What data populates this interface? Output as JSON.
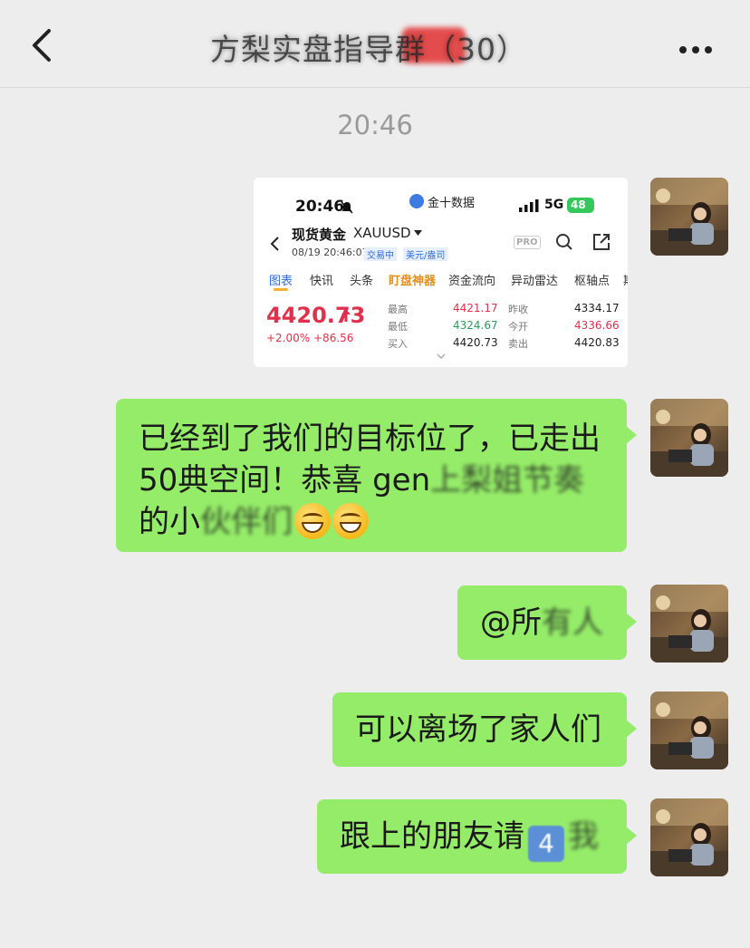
{
  "header": {
    "title": "方梨实盘指导群（30）",
    "badge": "梨"
  },
  "timestamp": "20:46",
  "messages": [
    {
      "type": "image",
      "screenshot": {
        "status_time": "20:46",
        "app_name": "金十数据",
        "network": "5G",
        "battery": "48",
        "instrument_name": "现货黄金",
        "symbol": "XAUUSD",
        "datetime": "08/19 20:46:07",
        "tag_trading": "交易中",
        "tag_currency": "美元/盎司",
        "pro_label": "PRO",
        "tabs": [
          "图表",
          "快讯",
          "头条",
          "盯盘神器",
          "资金流向",
          "异动雷达",
          "枢轴点",
          "期"
        ],
        "price": "4420.73",
        "change_pct": "+2.00%",
        "change_abs": "+86.56",
        "stats": {
          "high_label": "最高",
          "high": "4421.17",
          "low_label": "最低",
          "low": "4324.67",
          "bid_label": "买入",
          "bid": "4420.73",
          "prev_label": "昨收",
          "prev": "4334.17",
          "open_label": "今开",
          "open": "4336.66",
          "ask_label": "卖出",
          "ask": "4420.83"
        },
        "colors": {
          "up": "#e0314c",
          "down": "#2f9b58",
          "accent": "#2f6bd8"
        }
      }
    },
    {
      "type": "text",
      "line1_clear": "已经到了我们的目标位了，已走出",
      "line2_a": "50典",
      "line2_b": "空间！恭喜 gen",
      "line2_c": "上梨姐节奏",
      "line3_a": "的小",
      "line3_b": "伙伴们"
    },
    {
      "type": "text",
      "clear": "@所",
      "blurred": "有人"
    },
    {
      "type": "text",
      "clear": "可以离场了家人们",
      "blurred": ""
    },
    {
      "type": "text",
      "clear": "跟上的朋友请",
      "emoji_key": "4",
      "blurred": "我"
    }
  ],
  "bubble_color": "#95ec69",
  "background": "#ededed"
}
